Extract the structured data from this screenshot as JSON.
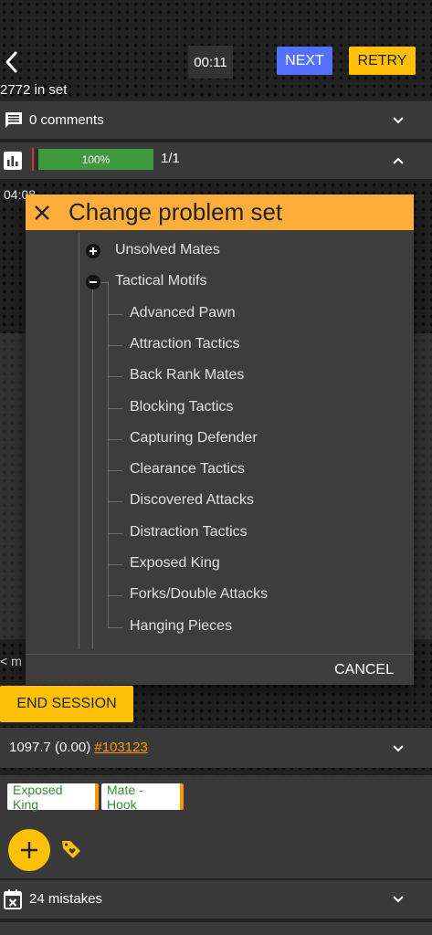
{
  "header": {
    "back_icon": "chevron-left-icon",
    "timer": "00:11",
    "next_label": "NEXT",
    "retry_label": "RETRY",
    "set_count": "2772 in set"
  },
  "comments": {
    "icon": "comment-icon",
    "label": "0 comments",
    "toggle_icon": "chevron-down-icon"
  },
  "stats": {
    "icon": "bar-chart-icon",
    "progress": 1.0,
    "progress_label": "100%",
    "count": "1/1",
    "toggle_icon": "chevron-up-icon"
  },
  "time_left": "04:08",
  "modal": {
    "title": "Change problem set",
    "close_icon": "close-icon",
    "nodes": [
      {
        "label": "Unsolved Mates",
        "toggle": "expand-icon"
      },
      {
        "label": "Tactical Motifs",
        "toggle": "collapse-icon",
        "children": [
          "Advanced Pawn",
          "Attraction Tactics",
          "Back Rank Mates",
          "Blocking Tactics",
          "Capturing Defender",
          "Clearance Tactics",
          "Discovered Attacks",
          "Distraction Tactics",
          "Exposed King",
          "Forks/Double Attacks",
          "Hanging Pieces"
        ]
      }
    ],
    "cancel_label": "CANCEL"
  },
  "behind_text": "< m",
  "end_session_label": "END SESSION",
  "rating": {
    "text": "1097.7 (0.00) ",
    "link": "#103123",
    "toggle_icon": "chevron-down-icon"
  },
  "tags": [
    "Exposed King",
    "Mate - Hook"
  ],
  "actions": {
    "add_icon": "plus-icon",
    "tag_icon": "tag-heart-icon"
  },
  "mistakes": {
    "icon": "calendar-x-icon",
    "label": "24 mistakes",
    "toggle_icon": "chevron-down-icon"
  },
  "colors": {
    "accent_yellow": "#ffc107",
    "modal_header": "#ffad3b",
    "next_blue": "#5470ff",
    "progress_green": "#3f9a3f",
    "link_orange": "#ff9800"
  }
}
